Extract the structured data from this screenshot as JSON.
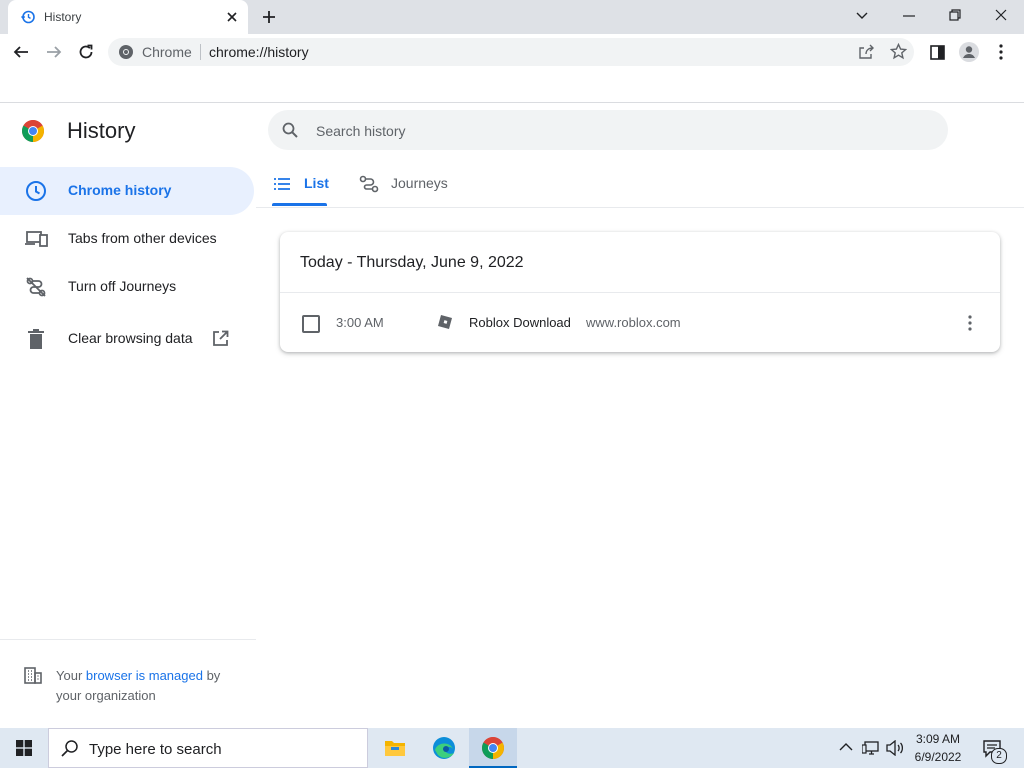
{
  "browser": {
    "tab_title": "History",
    "omnibox_label": "Chrome",
    "omnibox_url": "chrome://history"
  },
  "page": {
    "title": "History",
    "search_placeholder": "Search history"
  },
  "sidebar": {
    "items": [
      {
        "label": "Chrome history",
        "icon": "clock-icon",
        "active": true
      },
      {
        "label": "Tabs from other devices",
        "icon": "devices-icon",
        "active": false
      },
      {
        "label": "Turn off Journeys",
        "icon": "journeys-off-icon",
        "active": false
      },
      {
        "label": "Clear browsing data",
        "icon": "trash-icon",
        "active": false
      }
    ],
    "managed": {
      "prefix": "Your ",
      "link": "browser is managed",
      "suffix": " by",
      "line2": "your organization"
    }
  },
  "tabs": [
    {
      "label": "List",
      "icon": "list-icon",
      "active": true
    },
    {
      "label": "Journeys",
      "icon": "journeys-icon",
      "active": false
    }
  ],
  "history": {
    "date_header": "Today - Thursday, June 9, 2022",
    "entries": [
      {
        "time": "3:00 AM",
        "title": "Roblox Download",
        "domain": "www.roblox.com",
        "checked": false
      }
    ]
  },
  "taskbar": {
    "search_placeholder": "Type here to search",
    "time": "3:09 AM",
    "date": "6/9/2022",
    "notification_count": "2"
  },
  "colors": {
    "accent": "#1a73e8",
    "active_bg": "#e8f0fe",
    "tabstrip": "#dee1e6",
    "taskbar": "#dfe8f2"
  }
}
